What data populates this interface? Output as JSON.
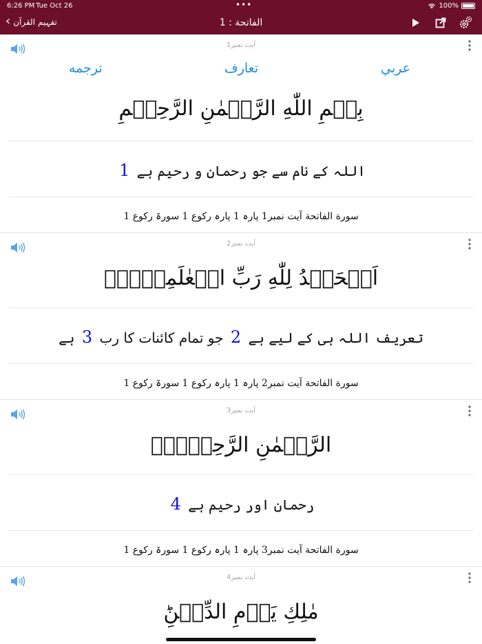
{
  "status": {
    "time": "6:26 PM",
    "date": "Tue Oct 26",
    "dots": "•••",
    "battery": "100%"
  },
  "nav": {
    "back_label": "تفہیم القرآن",
    "title": "الفاتحة : 1"
  },
  "tabs": {
    "arabic": "عربي",
    "taaruf": "تعارف",
    "tarjuma": "ترجمه"
  },
  "verses": [
    {
      "label": "آیت نمبر1",
      "arabic": "بِسۡمِ اللّٰهِ الرَّحۡمٰنِ الرَّحِيۡمِ",
      "urdu_pre": "اللہ کے نام سے جو رحمان و رحیم ہے",
      "urdu_mid": "",
      "note1": "1",
      "note2": "",
      "ref": "سورة الفاتحة آیت نمبر1  پارہ 1 پارہ رکوع 1 سورۃ رکوع 1"
    },
    {
      "label": "آیت نمبر2",
      "arabic": "اَلۡحَمۡدُ لِلّٰهِ رَبِّ الۡعٰلَمِيۡنَۙ",
      "urdu_pre": "تعریف اللہ ہی کے لیے ہے",
      "urdu_mid": "جو تمام کائنات کا رب",
      "urdu_post": "ہے",
      "note1": "2",
      "note2": "3",
      "ref": "سورة الفاتحة آیت نمبر2  پارہ 1 پارہ رکوع 1 سورۃ رکوع 1"
    },
    {
      "label": "آیت نمبر3",
      "arabic": "الرَّحۡمٰنِ الرَّحِيۡمِۙ",
      "urdu_pre": "رحمان اور رحیم ہے",
      "urdu_mid": "",
      "note1": "4",
      "note2": "",
      "ref": "سورة الفاتحة آیت نمبر3  پارہ 1 پارہ رکوع 1 سورۃ رکوع 1"
    },
    {
      "label": "آیت نمبر4",
      "arabic": "مٰلِكِ يَوۡمِ الدِّيۡنِؕ"
    }
  ],
  "colors": {
    "bar": "#6b0f2b",
    "tab": "#1a8ee0",
    "note": "#1010dd"
  },
  "icons": {
    "back": "chevron-left-icon",
    "play": "play-icon",
    "share": "share-icon",
    "settings": "gear-icon",
    "audio": "speaker-icon",
    "more": "more-vertical-icon"
  }
}
